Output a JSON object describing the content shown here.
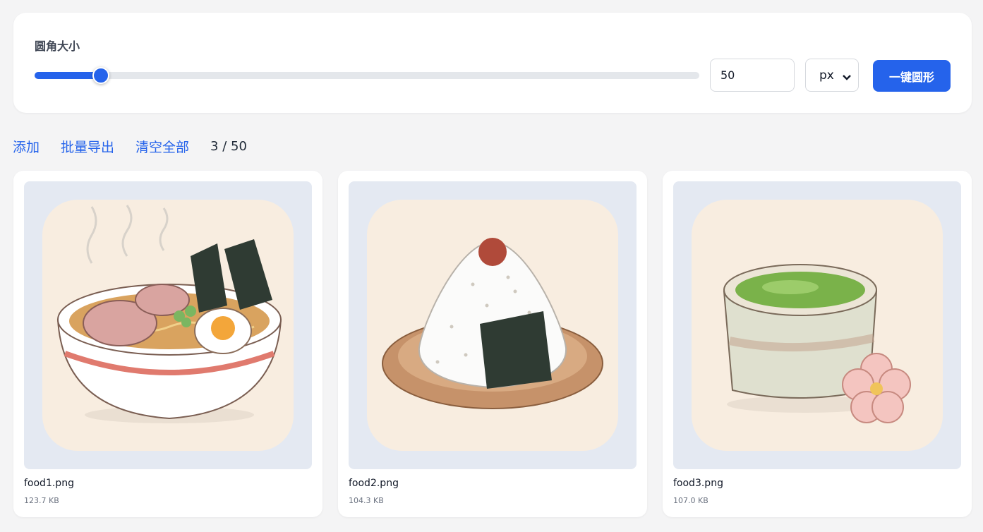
{
  "panel": {
    "label": "圆角大小",
    "slider_value": 50,
    "slider_max": 500,
    "input_value": "50",
    "unit": "px",
    "circle_button": "一键圆形"
  },
  "toolbar": {
    "add": "添加",
    "batch_export": "批量导出",
    "clear_all": "清空全部",
    "count": "3 / 50"
  },
  "cards": [
    {
      "name": "food1.png",
      "size": "123.7 KB",
      "image": "ramen-bowl-icon"
    },
    {
      "name": "food2.png",
      "size": "104.3 KB",
      "image": "onigiri-icon"
    },
    {
      "name": "food3.png",
      "size": "107.0 KB",
      "image": "matcha-tea-icon"
    }
  ],
  "colors": {
    "accent": "#2563eb",
    "preview_bg": "#e4e9f2",
    "image_bg": "#f8ede0"
  }
}
